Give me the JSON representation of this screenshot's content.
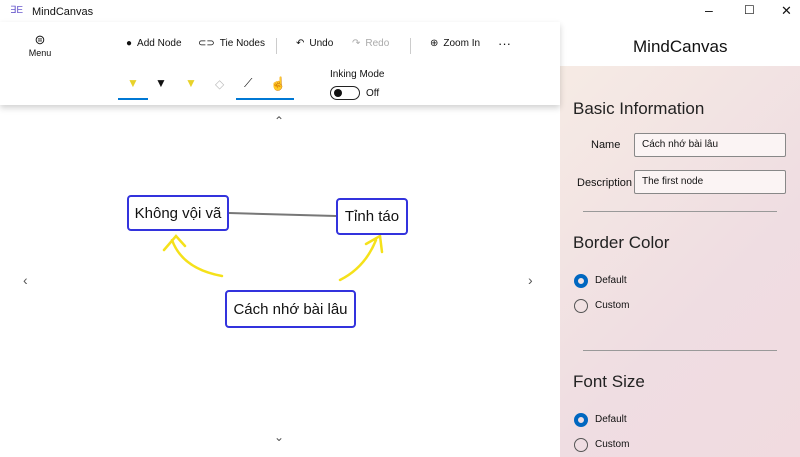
{
  "window": {
    "title": "MindCanvas",
    "icon": "app-logo-icon",
    "controls": [
      "minimize",
      "maximize",
      "close"
    ]
  },
  "toolbar": {
    "menu": "Menu",
    "add_node": "Add Node",
    "tie_nodes": "Tie Nodes",
    "undo": "Undo",
    "redo": "Redo",
    "zoom_in": "Zoom In",
    "more": "···",
    "inking_label": "Inking Mode",
    "inking_state": "Off",
    "inking_on": false,
    "pens": [
      "yellow-pen-icon",
      "black-pen-icon",
      "highlighter-icon",
      "eraser-icon",
      "ruler-icon",
      "touch-writing-icon"
    ]
  },
  "panel": {
    "title": "MindCanvas",
    "basic_info": "Basic Information",
    "name_label": "Name",
    "name_value": "Cách nhớ bài lâu",
    "desc_label": "Description",
    "desc_value": "The first node",
    "border_color": "Border Color",
    "font_size": "Font Size",
    "options": [
      "Default",
      "Custom"
    ],
    "selected": "Default"
  },
  "canvas": {
    "nodes": [
      "Không vội vã",
      "Tỉnh táo",
      "Cách nhớ bài lâu"
    ],
    "node_border": "#3333dd",
    "ink_color": "#f5e11a"
  }
}
